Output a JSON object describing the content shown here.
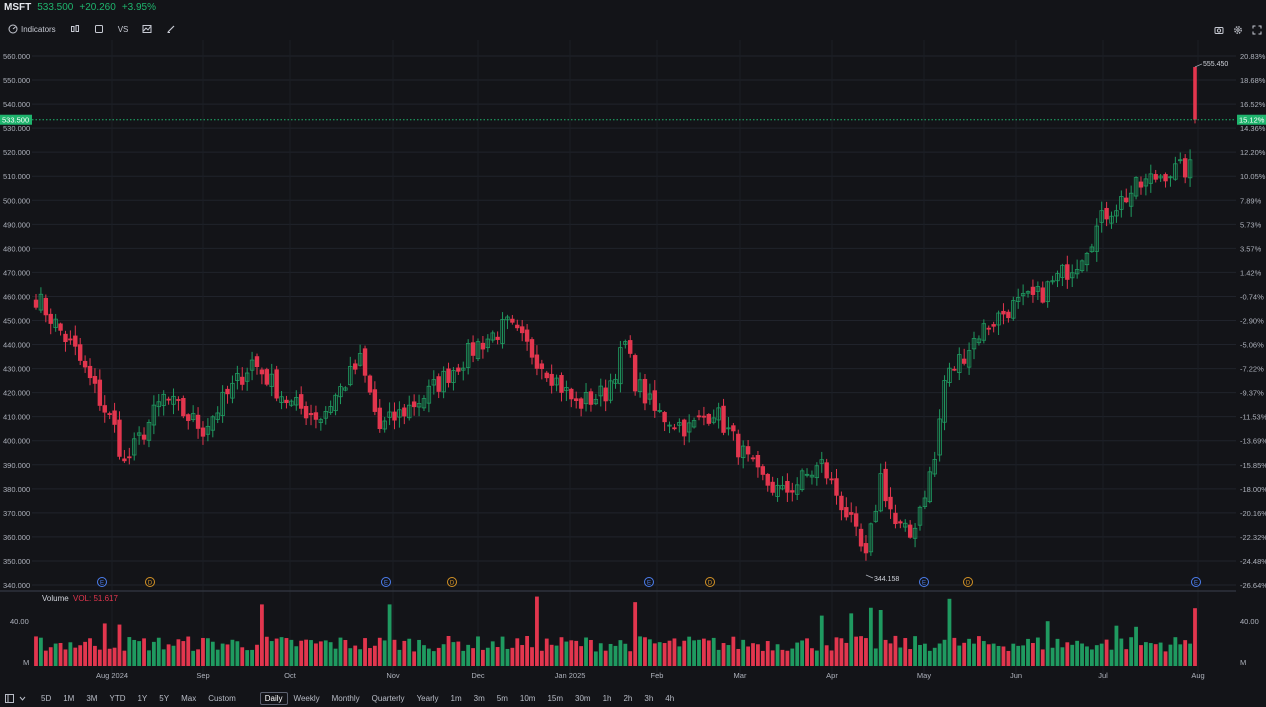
{
  "ticker": {
    "symbol": "MSFT",
    "price": "533.500",
    "change": "+20.260",
    "change_pct": "+3.95%"
  },
  "toolbar": {
    "indicators_label": "Indicators",
    "compare_label": "VS"
  },
  "volume_pane": {
    "label": "Volume",
    "value_label": "VOL: 51.617"
  },
  "timeframes": [
    "5D",
    "1M",
    "3M",
    "YTD",
    "1Y",
    "5Y",
    "Max",
    "Custom"
  ],
  "intervals": [
    "Daily",
    "Weekly",
    "Monthly",
    "Quarterly",
    "Yearly",
    "1m",
    "3m",
    "5m",
    "10m",
    "15m",
    "30m",
    "1h",
    "2h",
    "3h",
    "4h"
  ],
  "active_interval": "Daily",
  "colors": {
    "up": "#1f9a60",
    "down": "#e2364e",
    "background": "#131418",
    "grid": "#20232b",
    "price_line": "#1fb46d",
    "earnings": "#4c7ff0",
    "dividend": "#d49326"
  },
  "chart_data": {
    "type": "candlestick",
    "symbol": "MSFT",
    "y_axis_ticks": [
      "560.000",
      "550.000",
      "540.000",
      "530.000",
      "520.000",
      "510.000",
      "500.000",
      "490.000",
      "480.000",
      "470.000",
      "460.000",
      "450.000",
      "440.000",
      "430.000",
      "420.000",
      "410.000",
      "400.000",
      "390.000",
      "380.000",
      "370.000",
      "360.000",
      "350.000",
      "340.000"
    ],
    "pct_axis_ticks": [
      "20.83%",
      "18.68%",
      "16.52%",
      "14.36%",
      "12.20%",
      "10.05%",
      "7.89%",
      "5.73%",
      "3.57%",
      "1.42%",
      "-0.74%",
      "-2.90%",
      "-5.06%",
      "-7.22%",
      "-9.37%",
      "-11.53%",
      "-13.69%",
      "-15.85%",
      "-18.00%",
      "-20.16%",
      "-22.32%",
      "-24.48%",
      "-26.64%"
    ],
    "ylim": [
      340,
      560
    ],
    "x_axis_labels": [
      "Aug 2024",
      "Sep",
      "Oct",
      "Nov",
      "Dec",
      "Jan 2025",
      "Feb",
      "Mar",
      "Apr",
      "May",
      "Jun",
      "Jul",
      "Aug"
    ],
    "current_price": "533.500",
    "current_pct": "15.12%",
    "high_label": "555.450",
    "low_label": "344.158",
    "event_markers": [
      {
        "type": "E",
        "month": "Aug 2024"
      },
      {
        "type": "D",
        "month": "Aug 2024"
      },
      {
        "type": "E",
        "month": "Nov"
      },
      {
        "type": "D",
        "month": "Nov"
      },
      {
        "type": "E",
        "month": "Feb"
      },
      {
        "type": "D",
        "month": "Feb"
      },
      {
        "type": "E",
        "month": "May"
      },
      {
        "type": "D",
        "month": "May"
      },
      {
        "type": "E",
        "month": "Aug"
      }
    ],
    "volume_axis_ticks": [
      "40.00",
      "M"
    ],
    "anchors": [
      {
        "i": 0,
        "close": 460
      },
      {
        "i": 8,
        "close": 437
      },
      {
        "i": 16,
        "close": 405
      },
      {
        "i": 18,
        "close": 390
      },
      {
        "i": 26,
        "close": 418
      },
      {
        "i": 34,
        "close": 405
      },
      {
        "i": 44,
        "close": 433
      },
      {
        "i": 52,
        "close": 415
      },
      {
        "i": 58,
        "close": 410
      },
      {
        "i": 66,
        "close": 433
      },
      {
        "i": 70,
        "close": 405
      },
      {
        "i": 80,
        "close": 420
      },
      {
        "i": 90,
        "close": 440
      },
      {
        "i": 96,
        "close": 448
      },
      {
        "i": 104,
        "close": 430
      },
      {
        "i": 110,
        "close": 415
      },
      {
        "i": 116,
        "close": 420
      },
      {
        "i": 120,
        "close": 440
      },
      {
        "i": 122,
        "close": 425
      },
      {
        "i": 126,
        "close": 412
      },
      {
        "i": 133,
        "close": 405
      },
      {
        "i": 138,
        "close": 413
      },
      {
        "i": 147,
        "close": 385
      },
      {
        "i": 152,
        "close": 378
      },
      {
        "i": 160,
        "close": 390
      },
      {
        "i": 165,
        "close": 370
      },
      {
        "i": 169,
        "close": 350
      },
      {
        "i": 172,
        "close": 385
      },
      {
        "i": 175,
        "close": 365
      },
      {
        "i": 178,
        "close": 360
      },
      {
        "i": 183,
        "close": 392
      },
      {
        "i": 185,
        "close": 425
      },
      {
        "i": 192,
        "close": 445
      },
      {
        "i": 198,
        "close": 455
      },
      {
        "i": 204,
        "close": 460
      },
      {
        "i": 212,
        "close": 475
      },
      {
        "i": 218,
        "close": 495
      },
      {
        "i": 224,
        "close": 505
      },
      {
        "i": 230,
        "close": 512
      },
      {
        "i": 235,
        "close": 513
      },
      {
        "i": 236,
        "close": 533.5
      }
    ],
    "last_candle": {
      "open": 555.45,
      "high": 555.45,
      "low": 532,
      "close": 533.5
    },
    "volume": {
      "avg_millions": 20,
      "spikes": [
        {
          "i": 14,
          "v": 38
        },
        {
          "i": 17,
          "v": 37
        },
        {
          "i": 46,
          "v": 55
        },
        {
          "i": 72,
          "v": 55
        },
        {
          "i": 102,
          "v": 62
        },
        {
          "i": 122,
          "v": 57
        },
        {
          "i": 160,
          "v": 45
        },
        {
          "i": 166,
          "v": 47
        },
        {
          "i": 170,
          "v": 52
        },
        {
          "i": 172,
          "v": 50
        },
        {
          "i": 186,
          "v": 60
        },
        {
          "i": 206,
          "v": 40
        },
        {
          "i": 220,
          "v": 36
        },
        {
          "i": 224,
          "v": 35
        },
        {
          "i": 236,
          "v": 51.617
        }
      ]
    }
  }
}
